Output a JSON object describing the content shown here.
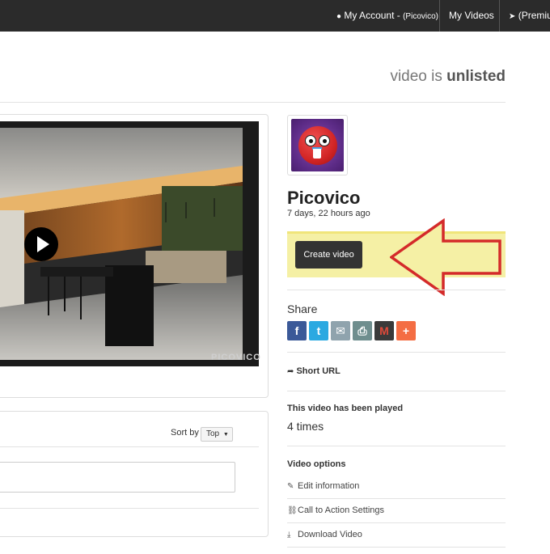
{
  "topbar": {
    "account_label": "My Account - ",
    "account_user": "(Picovico)",
    "my_videos": "My Videos",
    "premium": "(Premiu"
  },
  "status": {
    "prefix": "video is ",
    "value": "unlisted"
  },
  "player": {
    "watermark": "PICOVICO"
  },
  "comments": {
    "sort_label": "Sort by",
    "sort_value": "Top"
  },
  "profile": {
    "name": "Picovico",
    "time": "7 days, 22 hours ago"
  },
  "create_video": {
    "label": "Create video",
    "highlight_color": "#f5f0a5",
    "arrow_color": "#d42a2a"
  },
  "share": {
    "label": "Share",
    "icons": [
      {
        "name": "facebook-icon",
        "glyph": "f",
        "color": "#3b5998"
      },
      {
        "name": "twitter-icon",
        "glyph": "t",
        "color": "#2ba9e1"
      },
      {
        "name": "email-icon",
        "glyph": "✉",
        "color": "#8fa3ad"
      },
      {
        "name": "print-icon",
        "glyph": "⎙",
        "color": "#6f8e8e"
      },
      {
        "name": "gmail-icon",
        "glyph": "M",
        "color": "#3a3a3a"
      },
      {
        "name": "more-icon",
        "glyph": "+",
        "color": "#f46d43"
      }
    ]
  },
  "short_url": {
    "label": "Short URL"
  },
  "plays": {
    "label": "This video has been played",
    "count": "4 times"
  },
  "video_options": {
    "label": "Video options",
    "items": [
      {
        "label": "Edit information",
        "icon": "pencil-icon",
        "glyph": "✎"
      },
      {
        "label": "Call to Action Settings",
        "icon": "link-icon",
        "glyph": "⛓"
      },
      {
        "label": "Download Video",
        "icon": "download-icon",
        "glyph": "⤓"
      }
    ]
  }
}
